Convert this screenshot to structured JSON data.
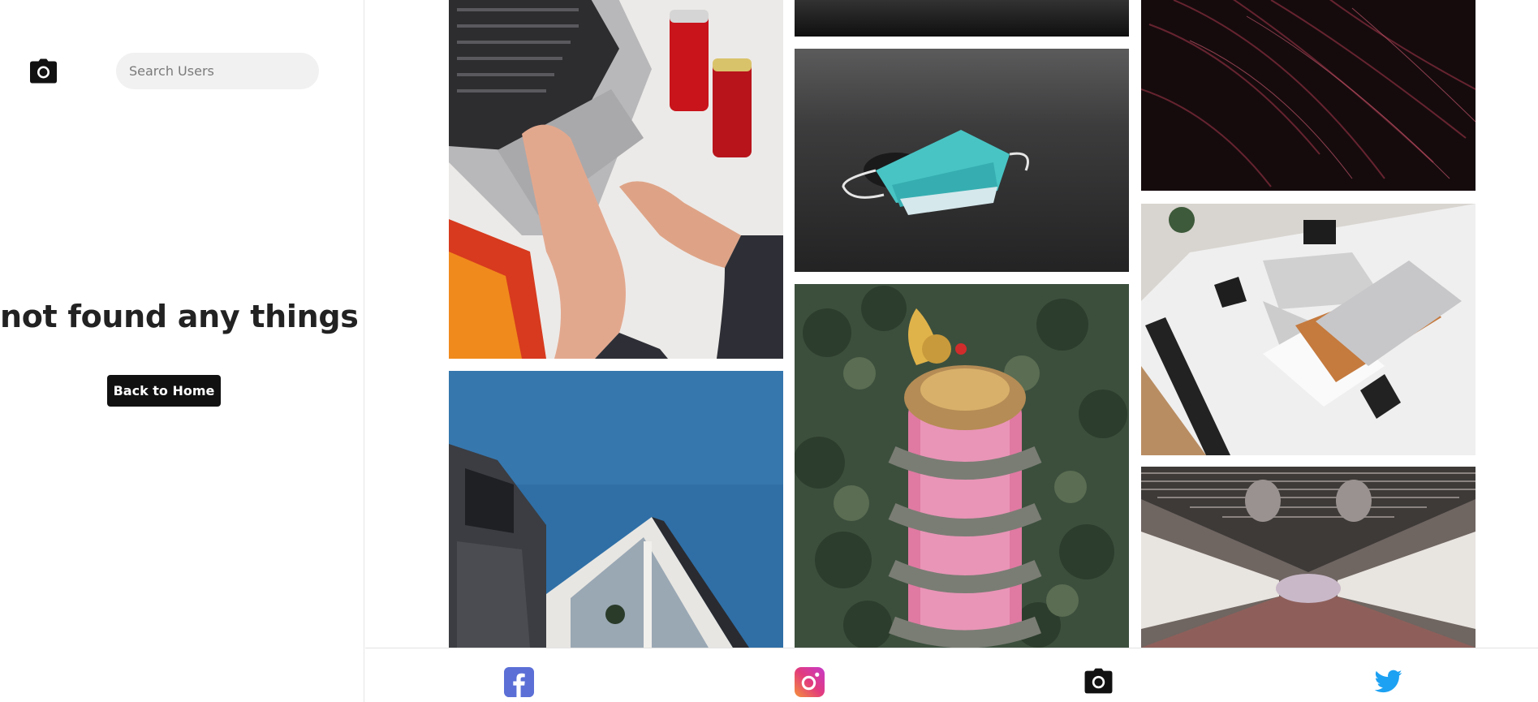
{
  "sidebar": {
    "logo_icon": "camera-icon",
    "search": {
      "placeholder": "Search Users",
      "value": ""
    },
    "not_found_message": "not found any things :(",
    "back_button_label": "Back to Home"
  },
  "gallery": {
    "columns": [
      {
        "photos": [
          "laptop-desk-cola",
          "blue-sky-building"
        ]
      },
      {
        "photos": [
          "dark-texture",
          "face-mask-on-ground",
          "dragon-temple-aerial"
        ]
      },
      {
        "photos": [
          "red-light-streaks",
          "white-desk-macbook",
          "subway-tunnel"
        ]
      }
    ]
  },
  "bottom_nav": {
    "items": [
      {
        "icon": "facebook-icon",
        "color": "#5b6fd6"
      },
      {
        "icon": "instagram-icon",
        "color": "#e23b7d"
      },
      {
        "icon": "camera-icon",
        "color": "#111111"
      },
      {
        "icon": "twitter-icon",
        "color": "#1da1f2"
      }
    ]
  }
}
